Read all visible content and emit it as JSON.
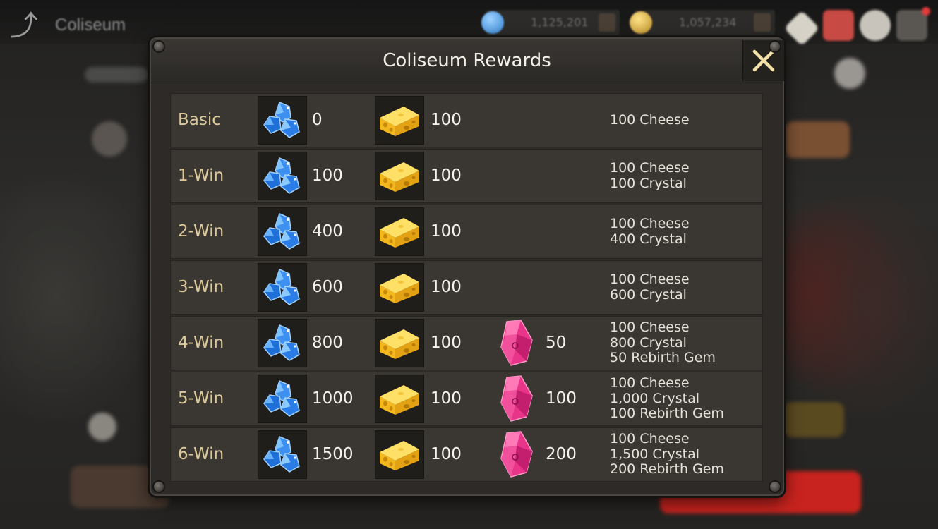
{
  "background": {
    "screen_title": "Coliseum",
    "crystal_amount": "1,125,201",
    "gold_amount": "1,057,234"
  },
  "dialog": {
    "title": "Coliseum Rewards",
    "rows": [
      {
        "label": "Basic",
        "crystal": "0",
        "cheese": "100",
        "gem": "",
        "summary": [
          "100 Cheese"
        ]
      },
      {
        "label": "1-Win",
        "crystal": "100",
        "cheese": "100",
        "gem": "",
        "summary": [
          "100 Cheese",
          "100 Crystal"
        ]
      },
      {
        "label": "2-Win",
        "crystal": "400",
        "cheese": "100",
        "gem": "",
        "summary": [
          "100 Cheese",
          "400 Crystal"
        ]
      },
      {
        "label": "3-Win",
        "crystal": "600",
        "cheese": "100",
        "gem": "",
        "summary": [
          "100 Cheese",
          "600 Crystal"
        ]
      },
      {
        "label": "4-Win",
        "crystal": "800",
        "cheese": "100",
        "gem": "50",
        "summary": [
          "100 Cheese",
          "800 Crystal",
          "50 Rebirth Gem"
        ]
      },
      {
        "label": "5-Win",
        "crystal": "1000",
        "cheese": "100",
        "gem": "100",
        "summary": [
          "100 Cheese",
          "1,000 Crystal",
          "100 Rebirth Gem"
        ]
      },
      {
        "label": "6-Win",
        "crystal": "1500",
        "cheese": "100",
        "gem": "200",
        "summary": [
          "100 Cheese",
          "1,500 Crystal",
          "200 Rebirth Gem"
        ]
      }
    ]
  },
  "icons": {
    "crystal": "blue-crystal-icon",
    "cheese": "cheese-icon",
    "gem": "rebirth-gem-icon",
    "close": "close-icon",
    "back": "back-arrow-icon"
  },
  "colors": {
    "label_gold": "#dcc99a",
    "close_x": "#f5e2a8",
    "gem_pink": "#e8358a",
    "crystal_blue": "#2f86e8",
    "cheese_yellow": "#f2b81e"
  }
}
